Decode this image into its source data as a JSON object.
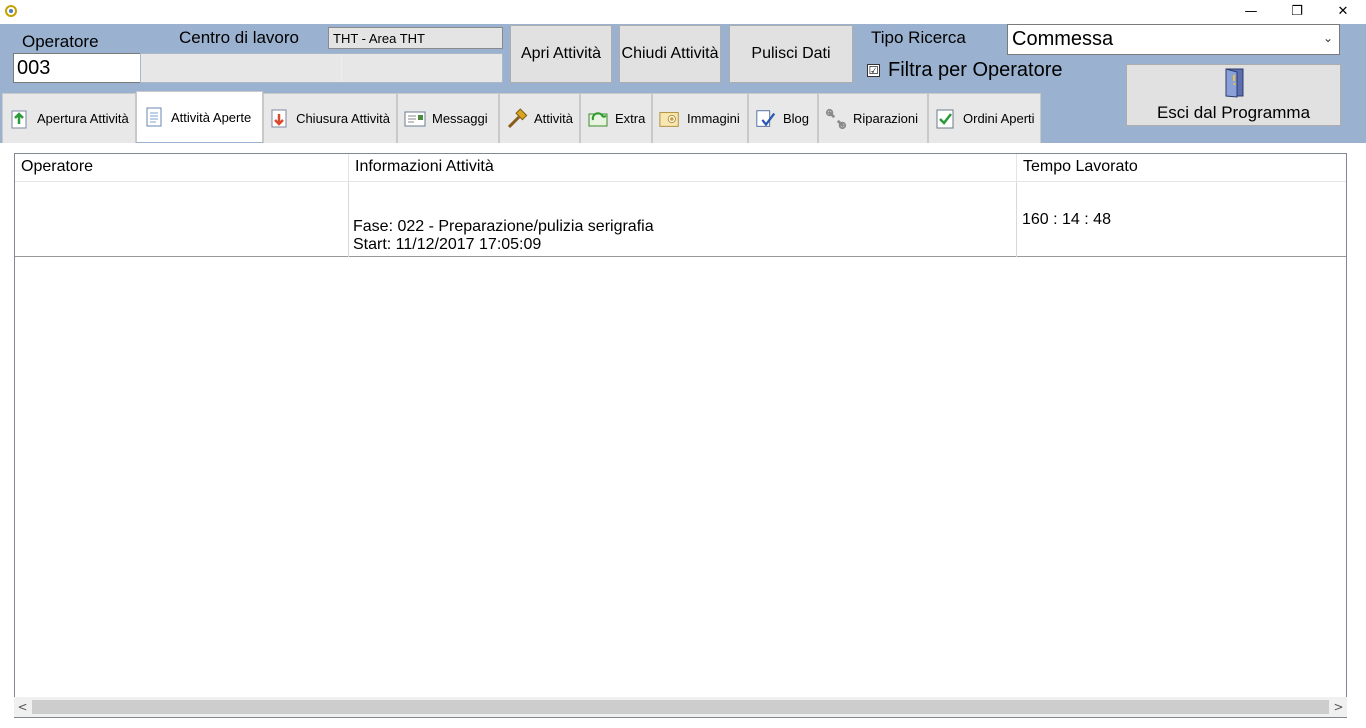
{
  "window": {
    "min_glyph": "—",
    "max_glyph": "❐",
    "close_glyph": "✕"
  },
  "panel": {
    "operatore_label": "Operatore",
    "operatore_value": "003",
    "centro_label": "Centro di lavoro",
    "centro_value": "THT - Area THT",
    "apri_label": "Apri Attività",
    "chiudi_label": "Chiudi Attività",
    "pulisci_label": "Pulisci Dati",
    "tipo_label": "Tipo Ricerca",
    "tipo_value": "Commessa",
    "filtra_label": "Filtra per Operatore",
    "filtra_checked": "☑",
    "esci_label": "Esci dal Programma"
  },
  "tabs": [
    {
      "label": "Apertura Attività",
      "icon": "upload-doc-icon"
    },
    {
      "label": "Attività Aperte",
      "icon": "document-icon",
      "active": true
    },
    {
      "label": "Chiusura Attività",
      "icon": "download-doc-icon"
    },
    {
      "label": "Messaggi",
      "icon": "message-icon"
    },
    {
      "label": "Attività",
      "icon": "hammer-icon"
    },
    {
      "label": "Extra",
      "icon": "extra-icon"
    },
    {
      "label": "Immagini",
      "icon": "image-icon"
    },
    {
      "label": "Blog",
      "icon": "blog-icon"
    },
    {
      "label": "Riparazioni",
      "icon": "wrench-icon"
    },
    {
      "label": "Ordini Aperti",
      "icon": "checkmark-icon"
    }
  ],
  "grid": {
    "columns": [
      "Operatore",
      "Informazioni Attività",
      "Tempo Lavorato"
    ],
    "rows": [
      {
        "operatore": "",
        "info_line1": "Fase: 022 - Preparazione/pulizia serigrafia",
        "info_line2": "Start: 11/12/2017 17:05:09",
        "tempo": "160 : 14 : 48"
      }
    ]
  },
  "scroll": {
    "left": "<",
    "right": ">"
  },
  "select_chevron": "⌄"
}
